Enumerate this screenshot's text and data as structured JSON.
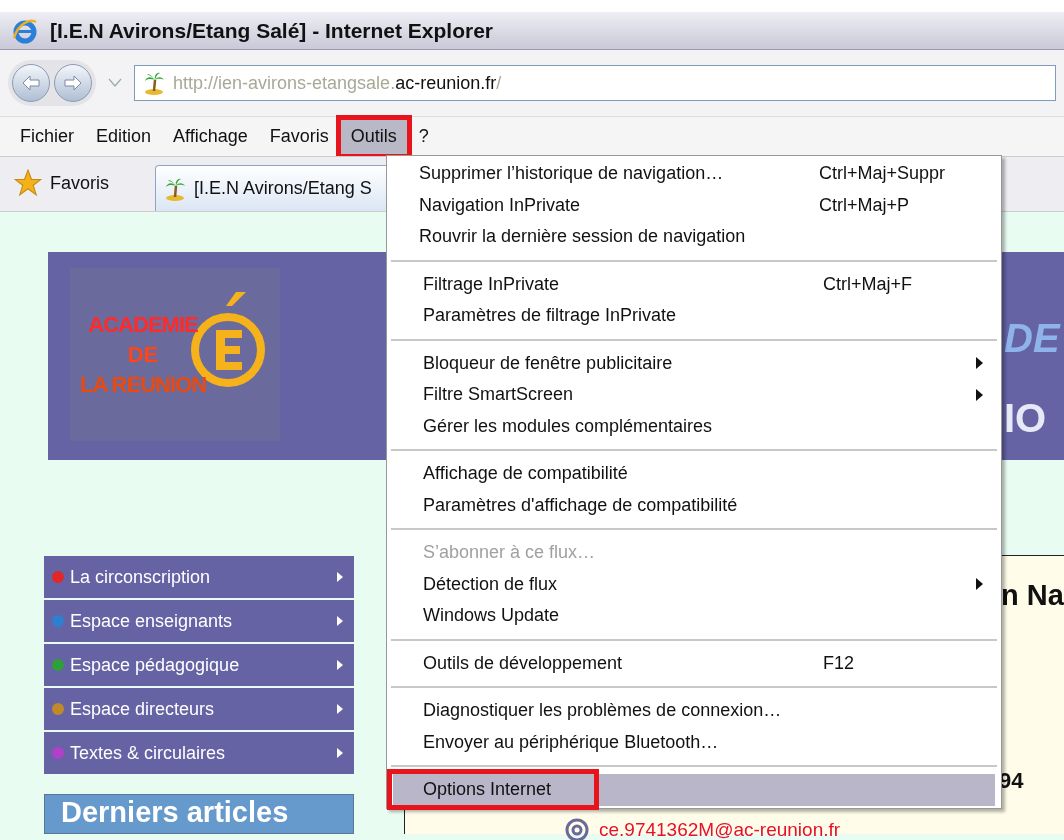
{
  "window": {
    "title": "[I.E.N Avirons/Etang Salé] - Internet Explorer"
  },
  "address_bar": {
    "url_prefix": "http://ien-avirons-etangsale.",
    "url_domain": "ac-reunion.fr",
    "url_suffix": "/"
  },
  "menu_bar": [
    {
      "label": "Fichier",
      "selected": false,
      "marked": false
    },
    {
      "label": "Edition",
      "selected": false,
      "marked": false
    },
    {
      "label": "Affichage",
      "selected": false,
      "marked": false
    },
    {
      "label": "Favoris",
      "selected": false,
      "marked": false
    },
    {
      "label": "Outils",
      "selected": true,
      "marked": true
    },
    {
      "label": "?",
      "selected": false,
      "marked": false
    }
  ],
  "favorites_bar": {
    "favorites_label": "Favoris",
    "tab_title": "[I.E.N Avirons/Etang S"
  },
  "tools_menu": {
    "groups": [
      [
        {
          "label": "Supprimer l’historique de navigation…",
          "shortcut": "Ctrl+Maj+Suppr",
          "submenu": false,
          "disabled": false,
          "selected": false,
          "marked": false
        },
        {
          "label": "Navigation InPrivate",
          "shortcut": "Ctrl+Maj+P",
          "submenu": false,
          "disabled": false,
          "selected": false,
          "marked": false
        },
        {
          "label": "Rouvrir la dernière session de navigation",
          "submenu": false,
          "disabled": false,
          "selected": false,
          "marked": false
        }
      ],
      [
        {
          "label": "Filtrage InPrivate",
          "shortcut": "Ctrl+Maj+F",
          "submenu": false,
          "disabled": false,
          "selected": false,
          "marked": false
        },
        {
          "label": "Paramètres de filtrage InPrivate",
          "submenu": false,
          "disabled": false,
          "selected": false,
          "marked": false
        }
      ],
      [
        {
          "label": "Bloqueur de fenêtre publicitaire",
          "submenu": true,
          "disabled": false,
          "selected": false,
          "marked": false
        },
        {
          "label": "Filtre SmartScreen",
          "submenu": true,
          "disabled": false,
          "selected": false,
          "marked": false
        },
        {
          "label": "Gérer les modules complémentaires",
          "submenu": false,
          "disabled": false,
          "selected": false,
          "marked": false
        }
      ],
      [
        {
          "label": "Affichage de compatibilité",
          "submenu": false,
          "disabled": false,
          "selected": false,
          "marked": false
        },
        {
          "label": "Paramètres d'affichage de compatibilité",
          "submenu": false,
          "disabled": false,
          "selected": false,
          "marked": false
        }
      ],
      [
        {
          "label": "S’abonner à ce flux…",
          "submenu": false,
          "disabled": true,
          "selected": false,
          "marked": false
        },
        {
          "label": "Détection de flux",
          "submenu": true,
          "disabled": false,
          "selected": false,
          "marked": false
        },
        {
          "label": "Windows Update",
          "submenu": false,
          "disabled": false,
          "selected": false,
          "marked": false
        }
      ],
      [
        {
          "label": "Outils de développement",
          "shortcut": "F12",
          "submenu": false,
          "disabled": false,
          "selected": false,
          "marked": false
        }
      ],
      [
        {
          "label": "Diagnostiquer les problèmes de connexion…",
          "submenu": false,
          "disabled": false,
          "selected": false,
          "marked": false
        },
        {
          "label": "Envoyer au périphérique Bluetooth…",
          "submenu": false,
          "disabled": false,
          "selected": false,
          "marked": false
        }
      ],
      [
        {
          "label": "Options Internet",
          "submenu": false,
          "disabled": false,
          "selected": true,
          "marked": true
        }
      ]
    ]
  },
  "page": {
    "logo": {
      "line_1": "ACADEMIE",
      "line_2": "DE",
      "line_3": "LA REUNION"
    },
    "banner_fragments": [
      "DE",
      "IO"
    ],
    "nav": [
      {
        "label": "La circonscription",
        "color": "#e02828"
      },
      {
        "label": "Espace enseignants",
        "color": "#2f7fd0"
      },
      {
        "label": "Espace pédagogique",
        "color": "#2f9f3a"
      },
      {
        "label": "Espace directeurs",
        "color": "#c08a2a"
      },
      {
        "label": "Textes & circulaires",
        "color": "#b040c8"
      }
    ],
    "section_heading": "Derniers articles",
    "content_fragments": [
      "n Na",
      "94"
    ],
    "email": "ce.9741362M@ac-reunion.fr"
  }
}
